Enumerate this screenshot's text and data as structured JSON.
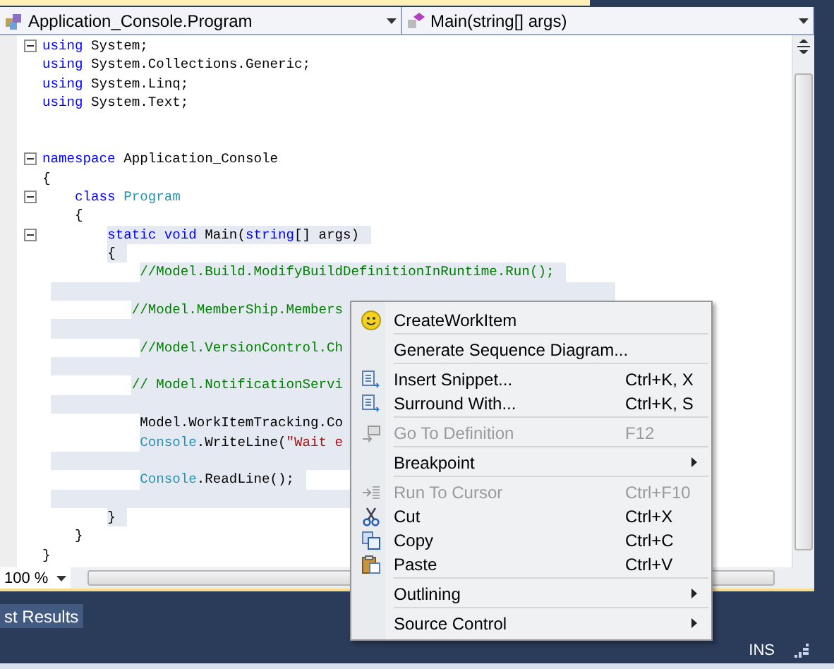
{
  "navigation_bar": {
    "type_dropdown": "Application_Console.Program",
    "member_dropdown": "Main(string[] args)"
  },
  "editor": {
    "lines": [
      {
        "kind": "code",
        "tokens": [
          {
            "text": "using",
            "kind": "keyword"
          },
          {
            "text": " System;",
            "kind": "plain"
          }
        ],
        "collapsible": true,
        "highlighted": false
      },
      {
        "kind": "code",
        "tokens": [
          {
            "text": "using",
            "kind": "keyword"
          },
          {
            "text": " System.Collections.Generic;",
            "kind": "plain"
          }
        ],
        "highlighted": false
      },
      {
        "kind": "code",
        "tokens": [
          {
            "text": "using",
            "kind": "keyword"
          },
          {
            "text": " System.Linq;",
            "kind": "plain"
          }
        ],
        "highlighted": false
      },
      {
        "kind": "code",
        "tokens": [
          {
            "text": "using",
            "kind": "keyword"
          },
          {
            "text": " System.Text;",
            "kind": "plain"
          }
        ],
        "highlighted": false
      },
      {
        "kind": "blank",
        "highlighted": false
      },
      {
        "kind": "blank",
        "highlighted": false
      },
      {
        "kind": "code",
        "tokens": [
          {
            "text": "namespace",
            "kind": "keyword"
          },
          {
            "text": " Application_Console",
            "kind": "plain"
          }
        ],
        "collapsible": true,
        "highlighted": false
      },
      {
        "kind": "code",
        "tokens": [
          {
            "text": "{",
            "kind": "plain"
          }
        ],
        "highlighted": false
      },
      {
        "kind": "code",
        "tokens": [
          {
            "text": "    class",
            "kind": "keyword"
          },
          {
            "text": " Program",
            "kind": "type"
          }
        ],
        "collapsible": true,
        "highlighted": false
      },
      {
        "kind": "code",
        "tokens": [
          {
            "text": "    {",
            "kind": "plain"
          }
        ],
        "highlighted": false
      },
      {
        "kind": "code",
        "tokens": [
          {
            "text": "        static void",
            "kind": "keyword"
          },
          {
            "text": " Main(",
            "kind": "plain"
          },
          {
            "text": "string",
            "kind": "keyword"
          },
          {
            "text": "[] args)",
            "kind": "plain"
          }
        ],
        "collapsible": true,
        "highlighted": true
      },
      {
        "kind": "code",
        "tokens": [
          {
            "text": "        {",
            "kind": "plain"
          }
        ],
        "highlighted": true
      },
      {
        "kind": "code",
        "tokens": [
          {
            "text": "            //Model.Build.ModifyBuildDefinitionInRuntime.Run();",
            "kind": "comment"
          }
        ],
        "highlighted": true
      },
      {
        "kind": "blank",
        "highlighted": true
      },
      {
        "kind": "code",
        "tokens": [
          {
            "text": "           //Model.MemberShip.Members",
            "kind": "comment"
          }
        ],
        "highlighted": true
      },
      {
        "kind": "blank",
        "highlighted": true
      },
      {
        "kind": "code",
        "tokens": [
          {
            "text": "            //Model.VersionControl.Ch",
            "kind": "comment"
          }
        ],
        "highlighted": true
      },
      {
        "kind": "blank",
        "highlighted": true
      },
      {
        "kind": "code",
        "tokens": [
          {
            "text": "           // Model.NotificationServi",
            "kind": "comment"
          }
        ],
        "highlighted": true
      },
      {
        "kind": "blank",
        "highlighted": true
      },
      {
        "kind": "code",
        "tokens": [
          {
            "text": "            Model.WorkItemTracking.Co",
            "kind": "plain"
          }
        ],
        "highlighted": true
      },
      {
        "kind": "code",
        "tokens": [
          {
            "text": "            Console",
            "kind": "type"
          },
          {
            "text": ".WriteLine(",
            "kind": "plain"
          },
          {
            "text": "\"Wait e",
            "kind": "string"
          }
        ],
        "highlighted": true
      },
      {
        "kind": "blank",
        "highlighted": true
      },
      {
        "kind": "code",
        "tokens": [
          {
            "text": "            Console",
            "kind": "type"
          },
          {
            "text": ".ReadLine();",
            "kind": "plain"
          }
        ],
        "highlighted": true
      },
      {
        "kind": "blank",
        "highlighted": true
      },
      {
        "kind": "code",
        "tokens": [
          {
            "text": "        }",
            "kind": "plain"
          }
        ],
        "highlighted": true
      },
      {
        "kind": "code",
        "tokens": [
          {
            "text": "    }",
            "kind": "plain"
          }
        ],
        "highlighted": false
      },
      {
        "kind": "code",
        "tokens": [
          {
            "text": "}",
            "kind": "plain"
          }
        ],
        "highlighted": false
      }
    ]
  },
  "zoom": {
    "value": "100 %"
  },
  "context_menu": {
    "groups": [
      [
        {
          "label": "CreateWorkItem",
          "disabled": false,
          "submenu": false
        }
      ],
      [
        {
          "label": "Generate Sequence Diagram...",
          "disabled": false,
          "submenu": false
        }
      ],
      [
        {
          "label": "Insert Snippet...",
          "shortcut": "Ctrl+K, X",
          "disabled": false,
          "submenu": false
        },
        {
          "label": "Surround With...",
          "shortcut": "Ctrl+K, S",
          "disabled": false,
          "submenu": false
        }
      ],
      [
        {
          "label": "Go To Definition",
          "shortcut": "F12",
          "disabled": true,
          "submenu": false
        }
      ],
      [
        {
          "label": "Breakpoint",
          "disabled": false,
          "submenu": true
        }
      ],
      [
        {
          "label": "Run To Cursor",
          "shortcut": "Ctrl+F10",
          "disabled": true,
          "submenu": false
        },
        {
          "label": "Cut",
          "shortcut": "Ctrl+X",
          "disabled": false,
          "submenu": false
        },
        {
          "label": "Copy",
          "shortcut": "Ctrl+C",
          "disabled": false,
          "submenu": false
        },
        {
          "label": "Paste",
          "shortcut": "Ctrl+V",
          "disabled": false,
          "submenu": false
        }
      ],
      [
        {
          "label": "Outlining",
          "disabled": false,
          "submenu": true
        }
      ],
      [
        {
          "label": "Source Control",
          "disabled": false,
          "submenu": true
        }
      ]
    ]
  },
  "output_panel": {
    "tab": "st Results"
  },
  "status_bar": {
    "mode": "INS"
  }
}
